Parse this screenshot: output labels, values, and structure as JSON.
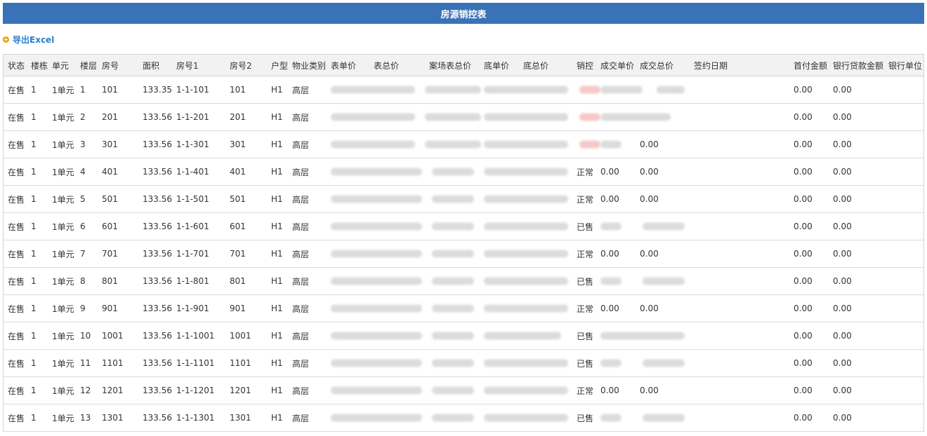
{
  "page_title": "房源销控表",
  "toolbar": {
    "export_label": "导出Excel"
  },
  "columns": [
    "状态",
    "楼栋",
    "单元",
    "楼层",
    "房号",
    "面积",
    "房号1",
    "房号2",
    "户型",
    "物业类别",
    "表单价",
    "表总价",
    "案场表总价",
    "底单价",
    "底总价",
    "销控",
    "成交单价",
    "成交总价",
    "签约日期",
    "首付金额",
    "银行贷款金额",
    "银行单位"
  ],
  "rows": [
    {
      "status": "在售",
      "building": "1",
      "unit": "1单元",
      "floor": "1",
      "room": "101",
      "area": "133.35",
      "room1": "1-1-101",
      "room2": "101",
      "layout": "H1",
      "property": "高层",
      "control": "",
      "deal_unit": "",
      "deal_total": "",
      "down": "0.00",
      "loan": "0.00"
    },
    {
      "status": "在售",
      "building": "1",
      "unit": "1单元",
      "floor": "2",
      "room": "201",
      "area": "133.56",
      "room1": "1-1-201",
      "room2": "201",
      "layout": "H1",
      "property": "高层",
      "control": "",
      "deal_unit": "",
      "deal_total": "",
      "down": "0.00",
      "loan": "0.00"
    },
    {
      "status": "在售",
      "building": "1",
      "unit": "1单元",
      "floor": "3",
      "room": "301",
      "area": "133.56",
      "room1": "1-1-301",
      "room2": "301",
      "layout": "H1",
      "property": "高层",
      "control": "",
      "deal_unit": "",
      "deal_total": "0.00",
      "down": "0.00",
      "loan": "0.00"
    },
    {
      "status": "在售",
      "building": "1",
      "unit": "1单元",
      "floor": "4",
      "room": "401",
      "area": "133.56",
      "room1": "1-1-401",
      "room2": "401",
      "layout": "H1",
      "property": "高层",
      "control": "正常",
      "deal_unit": "0.00",
      "deal_total": "0.00",
      "down": "0.00",
      "loan": "0.00"
    },
    {
      "status": "在售",
      "building": "1",
      "unit": "1单元",
      "floor": "5",
      "room": "501",
      "area": "133.56",
      "room1": "1-1-501",
      "room2": "501",
      "layout": "H1",
      "property": "高层",
      "control": "正常",
      "deal_unit": "0.00",
      "deal_total": "0.00",
      "down": "0.00",
      "loan": "0.00"
    },
    {
      "status": "在售",
      "building": "1",
      "unit": "1单元",
      "floor": "6",
      "room": "601",
      "area": "133.56",
      "room1": "1-1-601",
      "room2": "601",
      "layout": "H1",
      "property": "高层",
      "control": "已售",
      "deal_unit": "",
      "deal_total": "",
      "down": "0.00",
      "loan": "0.00"
    },
    {
      "status": "在售",
      "building": "1",
      "unit": "1单元",
      "floor": "7",
      "room": "701",
      "area": "133.56",
      "room1": "1-1-701",
      "room2": "701",
      "layout": "H1",
      "property": "高层",
      "control": "正常",
      "deal_unit": "0.00",
      "deal_total": "0.00",
      "down": "0.00",
      "loan": "0.00"
    },
    {
      "status": "在售",
      "building": "1",
      "unit": "1单元",
      "floor": "8",
      "room": "801",
      "area": "133.56",
      "room1": "1-1-801",
      "room2": "801",
      "layout": "H1",
      "property": "高层",
      "control": "已售",
      "deal_unit": "",
      "deal_total": "",
      "down": "0.00",
      "loan": "0.00"
    },
    {
      "status": "在售",
      "building": "1",
      "unit": "1单元",
      "floor": "9",
      "room": "901",
      "area": "133.56",
      "room1": "1-1-901",
      "room2": "901",
      "layout": "H1",
      "property": "高层",
      "control": "正常",
      "deal_unit": "0.00",
      "deal_total": "0.00",
      "down": "0.00",
      "loan": "0.00"
    },
    {
      "status": "在售",
      "building": "1",
      "unit": "1单元",
      "floor": "10",
      "room": "1001",
      "area": "133.56",
      "room1": "1-1-1001",
      "room2": "1001",
      "layout": "H1",
      "property": "高层",
      "control": "已售",
      "deal_unit": "",
      "deal_total": "",
      "down": "0.00",
      "loan": "0.00"
    },
    {
      "status": "在售",
      "building": "1",
      "unit": "1单元",
      "floor": "11",
      "room": "1101",
      "area": "133.56",
      "room1": "1-1-1101",
      "room2": "1101",
      "layout": "H1",
      "property": "高层",
      "control": "已售",
      "deal_unit": "",
      "deal_total": "",
      "down": "0.00",
      "loan": "0.00"
    },
    {
      "status": "在售",
      "building": "1",
      "unit": "1单元",
      "floor": "12",
      "room": "1201",
      "area": "133.56",
      "room1": "1-1-1201",
      "room2": "1201",
      "layout": "H1",
      "property": "高层",
      "control": "正常",
      "deal_unit": "0.00",
      "deal_total": "0.00",
      "down": "0.00",
      "loan": "0.00"
    },
    {
      "status": "在售",
      "building": "1",
      "unit": "1单元",
      "floor": "13",
      "room": "1301",
      "area": "133.56",
      "room1": "1-1-1301",
      "room2": "1301",
      "layout": "H1",
      "property": "高层",
      "control": "已售",
      "deal_unit": "",
      "deal_total": "",
      "down": "0.00",
      "loan": "0.00"
    }
  ]
}
